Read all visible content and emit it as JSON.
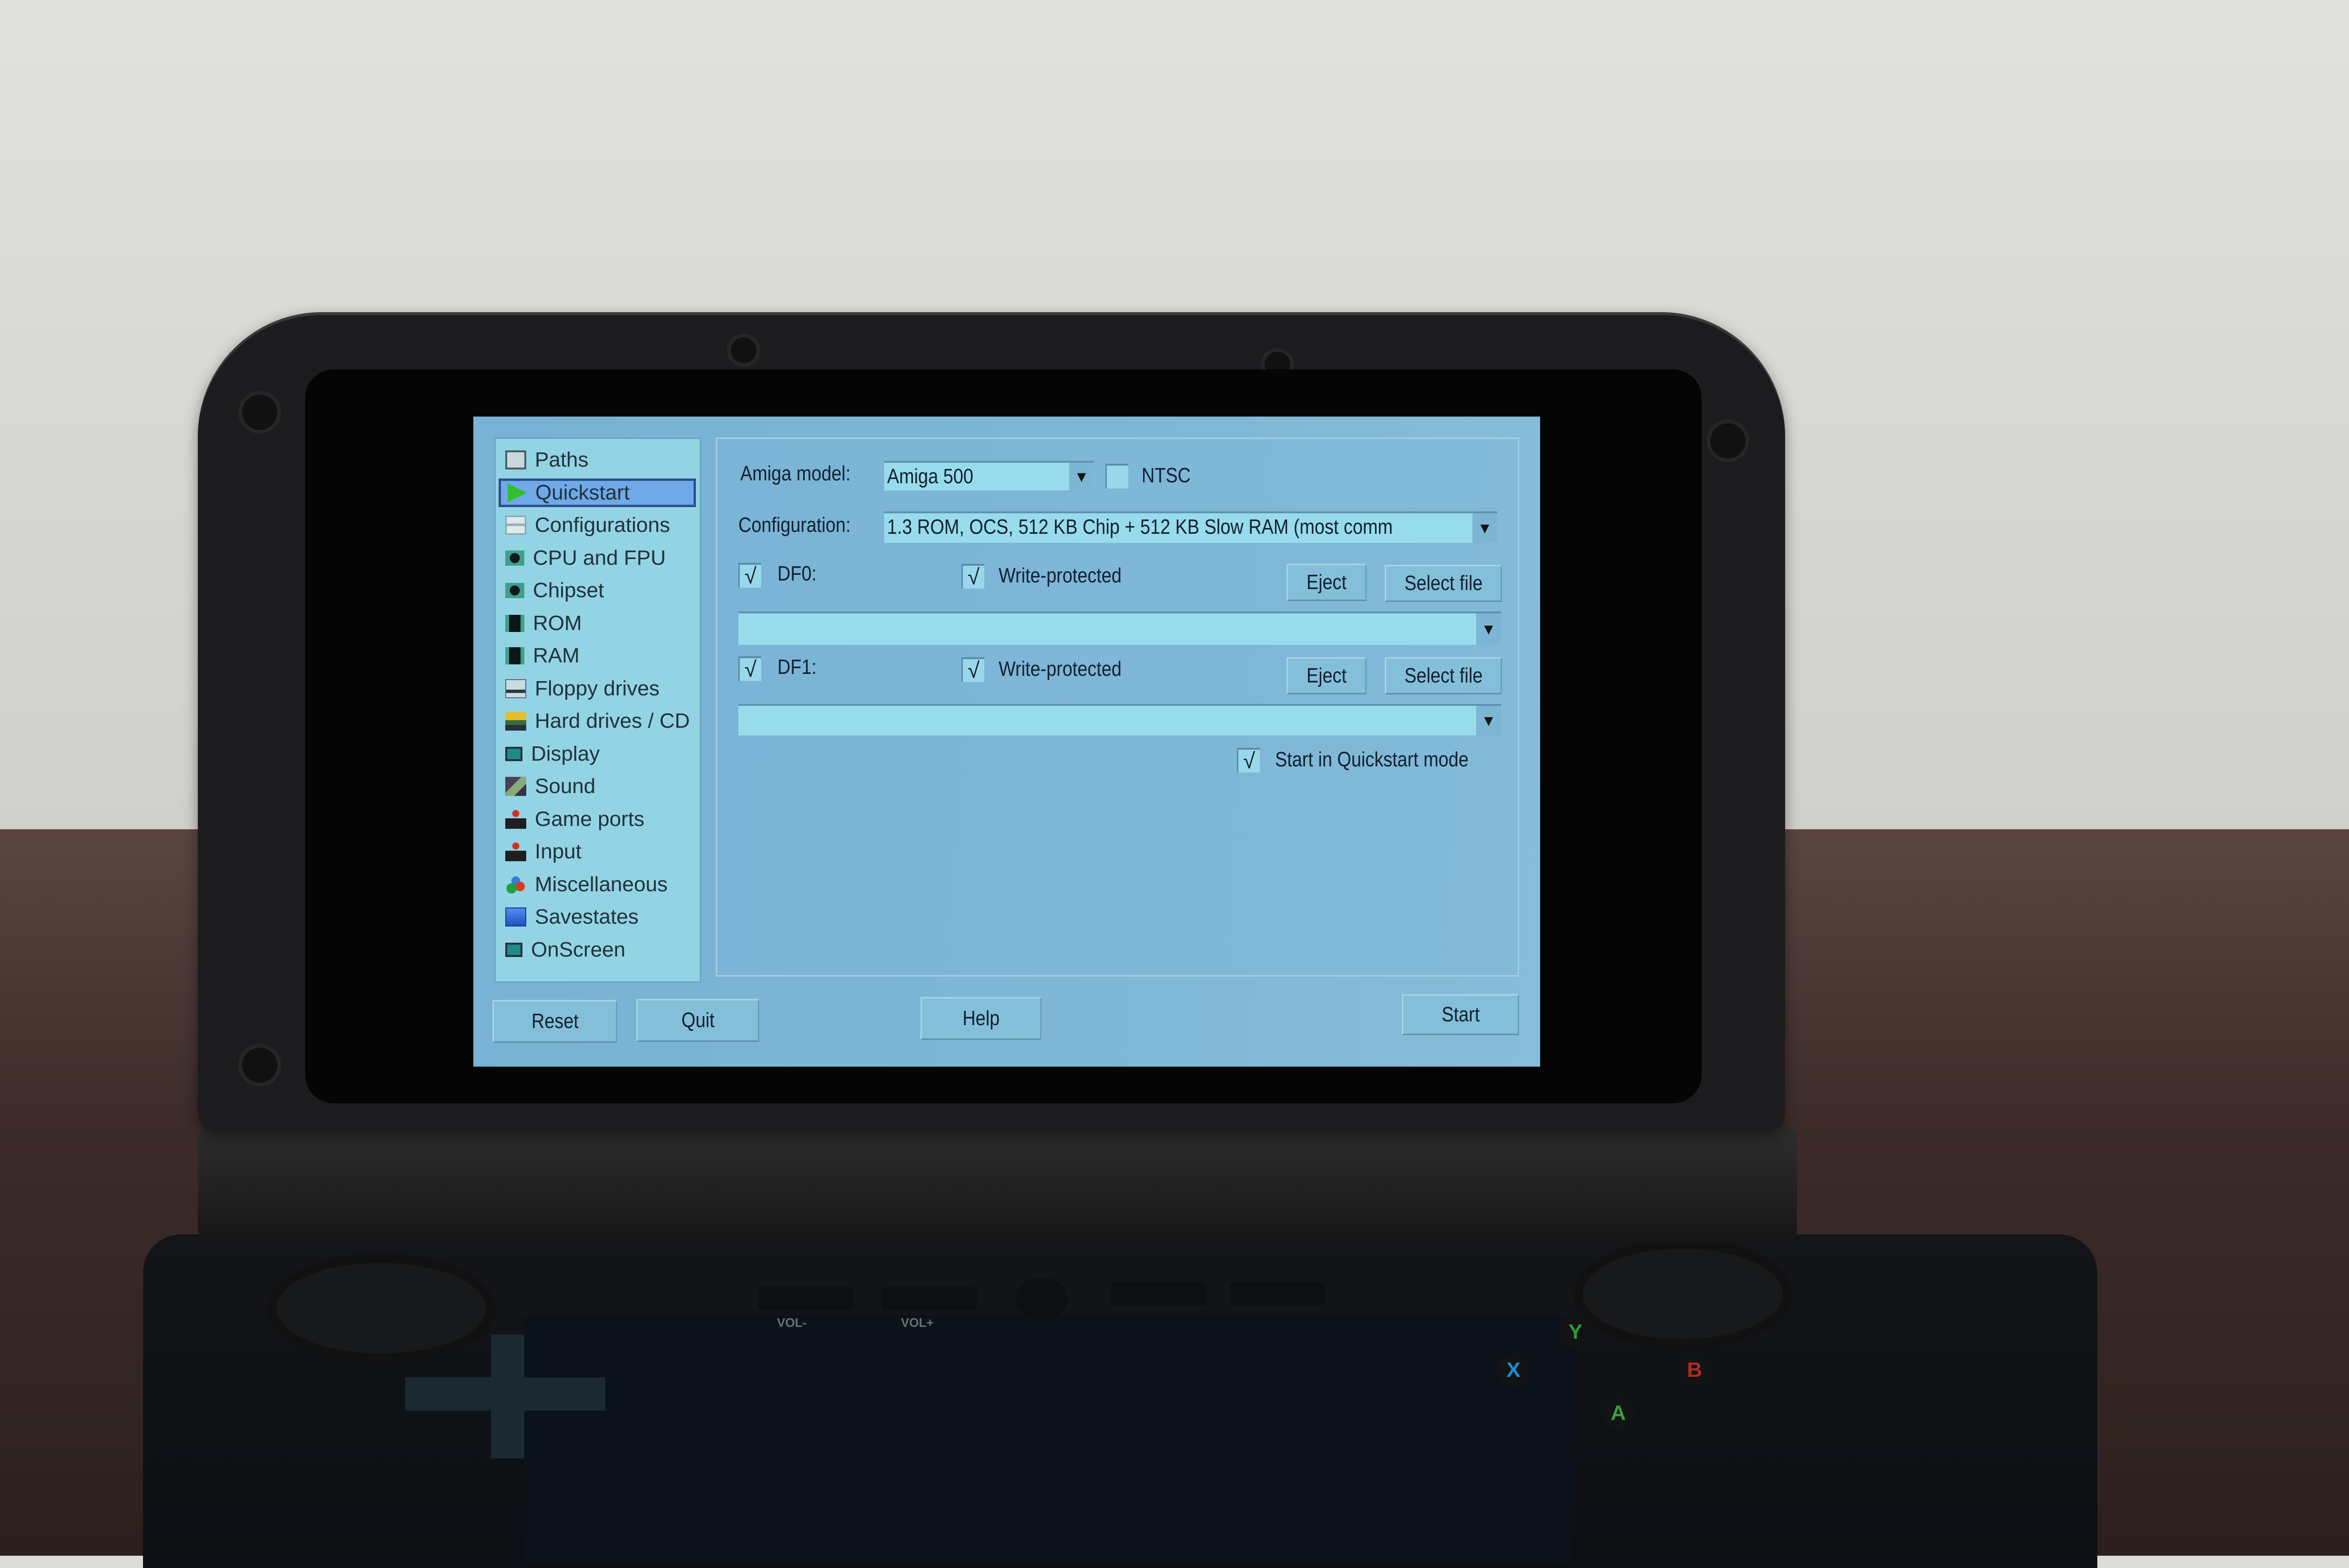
{
  "app": {
    "name": "Amiberry configuration GUI",
    "sidebar": {
      "items": [
        {
          "label": "Paths",
          "icon": "folder-path-icon"
        },
        {
          "label": "Quickstart",
          "icon": "play-arrow-icon",
          "selected": true
        },
        {
          "label": "Configurations",
          "icon": "config-list-icon"
        },
        {
          "label": "CPU and FPU",
          "icon": "chip-icon"
        },
        {
          "label": "Chipset",
          "icon": "chip-icon"
        },
        {
          "label": "ROM",
          "icon": "memory-module-icon"
        },
        {
          "label": "RAM",
          "icon": "memory-module-icon"
        },
        {
          "label": "Floppy drives",
          "icon": "floppy-drive-icon"
        },
        {
          "label": "Hard drives / CD",
          "icon": "hard-drive-icon"
        },
        {
          "label": "Display",
          "icon": "monitor-icon"
        },
        {
          "label": "Sound",
          "icon": "sound-icon"
        },
        {
          "label": "Game ports",
          "icon": "joystick-icon"
        },
        {
          "label": "Input",
          "icon": "joystick-icon"
        },
        {
          "label": "Miscellaneous",
          "icon": "misc-blocks-icon"
        },
        {
          "label": "Savestates",
          "icon": "save-disk-icon"
        },
        {
          "label": "OnScreen",
          "icon": "monitor-icon"
        }
      ]
    },
    "quickstart": {
      "amiga_model_label": "Amiga model:",
      "amiga_model_value": "Amiga 500",
      "ntsc_label": "NTSC",
      "ntsc_checked": false,
      "configuration_label": "Configuration:",
      "configuration_value": "1.3 ROM, OCS, 512 KB Chip + 512 KB Slow RAM (most comm",
      "drives": [
        {
          "label": "DF0:",
          "enabled": true,
          "write_protected_label": "Write-protected",
          "write_protected": true,
          "eject_label": "Eject",
          "select_label": "Select file",
          "file_value": ""
        },
        {
          "label": "DF1:",
          "enabled": true,
          "write_protected_label": "Write-protected",
          "write_protected": true,
          "eject_label": "Eject",
          "select_label": "Select file",
          "file_value": ""
        }
      ],
      "start_quickstart_label": "Start in Quickstart mode",
      "start_quickstart_checked": true,
      "check_glyph": "√",
      "dropdown_glyph": "▼"
    },
    "footer": {
      "reset_label": "Reset",
      "quit_label": "Quit",
      "help_label": "Help",
      "start_label": "Start"
    }
  },
  "device": {
    "buttons": [
      "VOL-",
      "VOL+"
    ],
    "face_buttons": [
      {
        "label": "X",
        "color": "#1c8fd0"
      },
      {
        "label": "Y",
        "color": "#2a9a3a"
      },
      {
        "label": "B",
        "color": "#b02a20"
      },
      {
        "label": "A",
        "color": "#3aa038"
      }
    ]
  },
  "colors": {
    "screen_bg": "#7db6d6",
    "sidebar_bg": "#93d4e4",
    "selection_bg": "#6fa9e8",
    "selection_border": "#2d4e8e",
    "play_icon": "#2fc02f",
    "text": "#102030"
  }
}
